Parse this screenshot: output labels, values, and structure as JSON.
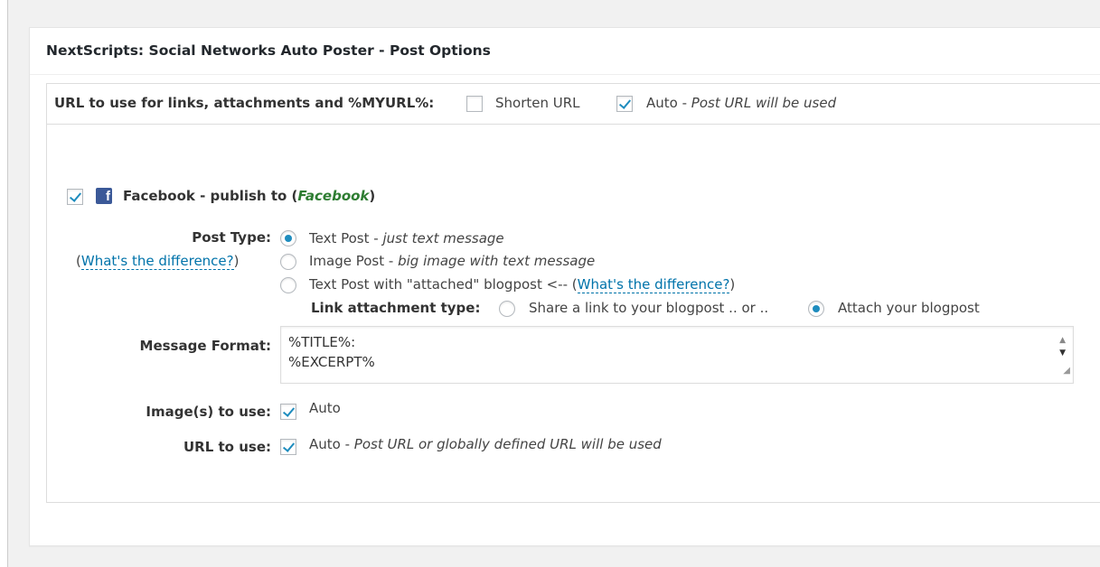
{
  "panel": {
    "title": "NextScripts: Social Networks Auto Poster - Post Options"
  },
  "url_bar": {
    "label": "URL to use for links, attachments and %MYURL%:",
    "shorten_label": "Shorten URL",
    "auto_label": "Auto - ",
    "auto_desc": "Post URL will be used",
    "shorten_checked": false,
    "auto_checked": true
  },
  "facebook": {
    "checked": true,
    "prefix": "Facebook - publish to (",
    "name": "Facebook",
    "suffix": ")"
  },
  "post_type": {
    "label": "Post Type:",
    "whats_diff_open": "(",
    "whats_diff": "What's the difference?",
    "whats_diff_close": ")",
    "options": [
      {
        "label": "Text Post - ",
        "desc": "just text message",
        "checked": true
      },
      {
        "label": "Image Post - ",
        "desc": "big image with text message",
        "checked": false
      },
      {
        "label": "Text Post with \"attached\" blogpost <-- (",
        "desc": "What's the difference?",
        "tail": ")",
        "checked": false
      }
    ]
  },
  "link_attachment": {
    "label": "Link attachment type:",
    "share_label": "Share a link to your blogpost .. or ..",
    "attach_label": "Attach your blogpost",
    "attach_checked": true
  },
  "message_format": {
    "label": "Message Format:",
    "line1": "%TITLE%:",
    "line2": "%EXCERPT%"
  },
  "images": {
    "label": "Image(s) to use:",
    "value": "Auto",
    "checked": true
  },
  "url_to_use": {
    "label": "URL to use:",
    "value": "Auto - ",
    "desc": "Post URL or globally defined URL will be used",
    "checked": true
  }
}
